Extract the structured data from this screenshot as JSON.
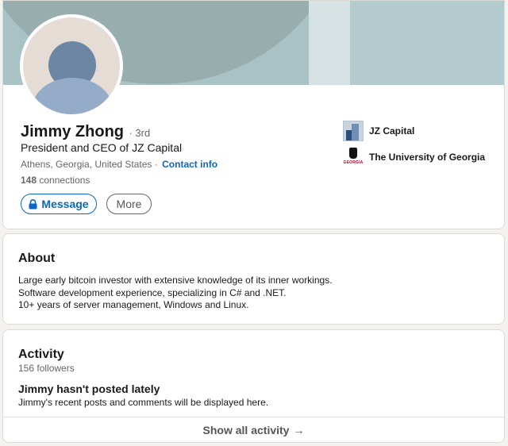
{
  "profile": {
    "name": "Jimmy Zhong",
    "degree": "· 3rd",
    "headline": "President and CEO of JZ Capital",
    "location": "Athens, Georgia, United States",
    "separator": "·",
    "contact_info": "Contact info",
    "connections_count": "148",
    "connections_label": "connections"
  },
  "actions": {
    "message_label": "Message",
    "more_label": "More"
  },
  "side": {
    "company": "JZ Capital",
    "school": "The University of Georgia",
    "school_logo_text": "GEORGIA"
  },
  "about": {
    "title": "About",
    "lines": [
      "Large early bitcoin investor with extensive knowledge of its inner workings.",
      "Software development experience, specializing in C# and .NET.",
      "10+ years of server management, Windows and Linux."
    ]
  },
  "activity": {
    "title": "Activity",
    "followers": "156 followers",
    "empty_title": "Jimmy hasn't posted lately",
    "empty_subtitle": "Jimmy's recent posts and comments will be displayed here.",
    "show_all": "Show all activity",
    "show_all_arrow": "→"
  },
  "colors": {
    "accent": "#0a66c2",
    "banner": "#a9c3c4",
    "page_bg": "#f3f2ef"
  },
  "icons": {
    "message_button": "lock-icon",
    "show_all": "arrow-right-icon"
  }
}
